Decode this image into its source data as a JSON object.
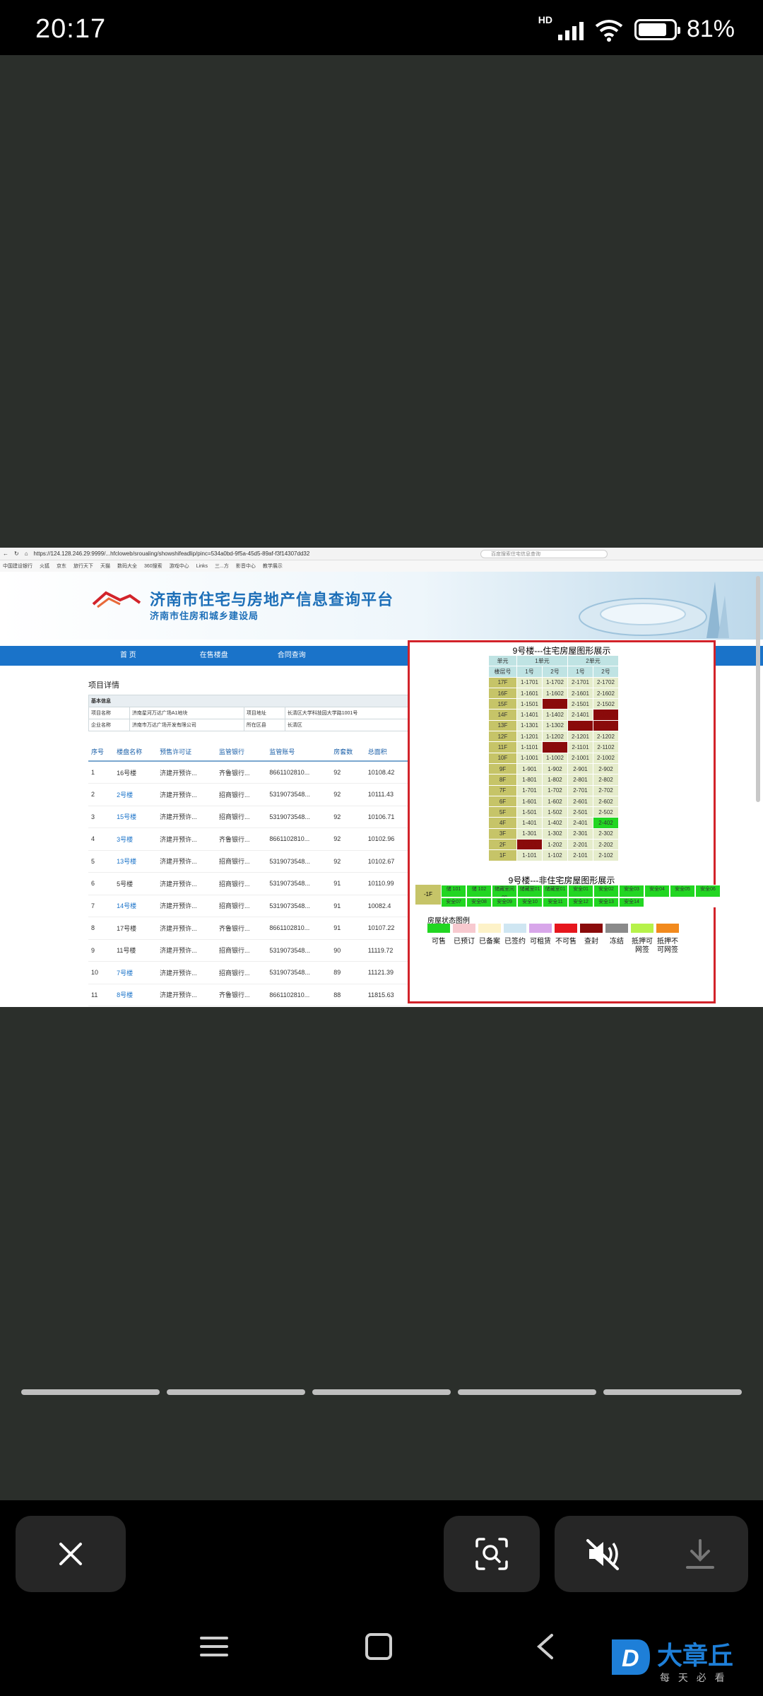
{
  "status_bar": {
    "time": "20:17",
    "network": "HD",
    "battery": "81%",
    "battery_level": 0.81
  },
  "browser": {
    "url": "https://124.128.246.29:9999/...hfcloweb/sroualing/showshifeadlip/pinc=534a0bd-9f5a-45d5-89af-f3f14307dd32",
    "search_placeholder": "百度搜索住宅信息查询",
    "bookmarks": [
      "中国建设银行",
      "火狐",
      "京东",
      "旅行天下",
      "天猫",
      "数码大全",
      "360搜索",
      "游戏中心",
      "Links",
      "三...方",
      "影音中心",
      "教学展示"
    ]
  },
  "site": {
    "title": "济南市住宅与房地产信息查询平台",
    "subtitle": "济南市住房和城乡建设局",
    "nav": [
      "首  页",
      "在售楼盘",
      "合同查询"
    ]
  },
  "project": {
    "section_title": "项目详情",
    "info_header": "基本信息",
    "info_rows": [
      [
        "项目名称",
        "济南星河万达广场A1地块",
        "项目地址",
        "长清区大学科技园大学路1001号"
      ],
      [
        "企业名称",
        "济南市万达广场开发有限公司",
        "所在区县",
        "长清区"
      ]
    ],
    "columns": [
      "序号",
      "楼盘名称",
      "预售许可证",
      "监管银行",
      "监管账号",
      "房套数",
      "总面积"
    ],
    "rows": [
      [
        "1",
        "16号楼",
        "济建开预许...",
        "齐鲁银行...",
        "8661102810...",
        "92",
        "10108.42"
      ],
      [
        "2",
        "2号楼",
        "济建开预许...",
        "招商银行...",
        "5319073548...",
        "92",
        "10111.43"
      ],
      [
        "3",
        "15号楼",
        "济建开预许...",
        "招商银行...",
        "5319073548...",
        "92",
        "10106.71"
      ],
      [
        "4",
        "3号楼",
        "济建开预许...",
        "齐鲁银行...",
        "8661102810...",
        "92",
        "10102.96"
      ],
      [
        "5",
        "13号楼",
        "济建开预许...",
        "招商银行...",
        "5319073548...",
        "92",
        "10102.67"
      ],
      [
        "6",
        "5号楼",
        "济建开预许...",
        "招商银行...",
        "5319073548...",
        "91",
        "10110.99"
      ],
      [
        "7",
        "14号楼",
        "济建开预许...",
        "招商银行...",
        "5319073548...",
        "91",
        "10082.4"
      ],
      [
        "8",
        "17号楼",
        "济建开预许...",
        "齐鲁银行...",
        "8661102810...",
        "91",
        "10107.22"
      ],
      [
        "9",
        "11号楼",
        "济建开预许...",
        "招商银行...",
        "5319073548...",
        "90",
        "11119.72"
      ],
      [
        "10",
        "7号楼",
        "济建开预许...",
        "招商银行...",
        "5319073548...",
        "89",
        "11121.39"
      ],
      [
        "11",
        "8号楼",
        "济建开预许...",
        "齐鲁银行...",
        "8661102810...",
        "88",
        "11815.63"
      ]
    ]
  },
  "building": {
    "title": "9号楼---住宅房屋图形展示",
    "unit_label": "单元",
    "units": [
      "1单元",
      "2单元"
    ],
    "floor_col": "楼层号",
    "room_cols": [
      "1号",
      "2号",
      "1号",
      "2号"
    ],
    "floors": [
      {
        "floor": "17F",
        "rooms": [
          "1-1701",
          "1-1702",
          "2-1701",
          "2-1702"
        ],
        "status": [
          "n",
          "n",
          "n",
          "n"
        ]
      },
      {
        "floor": "16F",
        "rooms": [
          "1-1601",
          "1-1602",
          "2-1601",
          "2-1602"
        ],
        "status": [
          "n",
          "n",
          "n",
          "n"
        ]
      },
      {
        "floor": "15F",
        "rooms": [
          "1-1501",
          "1-1502",
          "2-1501",
          "2-1502"
        ],
        "status": [
          "n",
          "d",
          "n",
          "n"
        ]
      },
      {
        "floor": "14F",
        "rooms": [
          "1-1401",
          "1-1402",
          "2-1401",
          "2-1402"
        ],
        "status": [
          "n",
          "n",
          "n",
          "d"
        ]
      },
      {
        "floor": "13F",
        "rooms": [
          "1-1301",
          "1-1302",
          "2-1301",
          "2-1302"
        ],
        "status": [
          "n",
          "n",
          "d",
          "d"
        ]
      },
      {
        "floor": "12F",
        "rooms": [
          "1-1201",
          "1-1202",
          "2-1201",
          "2-1202"
        ],
        "status": [
          "n",
          "n",
          "n",
          "n"
        ]
      },
      {
        "floor": "11F",
        "rooms": [
          "1-1101",
          "1-1102",
          "2-1101",
          "2-1102"
        ],
        "status": [
          "n",
          "d",
          "n",
          "n"
        ]
      },
      {
        "floor": "10F",
        "rooms": [
          "1-1001",
          "1-1002",
          "2-1001",
          "2-1002"
        ],
        "status": [
          "n",
          "n",
          "n",
          "n"
        ]
      },
      {
        "floor": "9F",
        "rooms": [
          "1-901",
          "1-902",
          "2-901",
          "2-902"
        ],
        "status": [
          "n",
          "n",
          "n",
          "n"
        ]
      },
      {
        "floor": "8F",
        "rooms": [
          "1-801",
          "1-802",
          "2-801",
          "2-802"
        ],
        "status": [
          "n",
          "n",
          "n",
          "n"
        ]
      },
      {
        "floor": "7F",
        "rooms": [
          "1-701",
          "1-702",
          "2-701",
          "2-702"
        ],
        "status": [
          "n",
          "n",
          "n",
          "n"
        ]
      },
      {
        "floor": "6F",
        "rooms": [
          "1-601",
          "1-602",
          "2-601",
          "2-602"
        ],
        "status": [
          "n",
          "n",
          "n",
          "n"
        ]
      },
      {
        "floor": "5F",
        "rooms": [
          "1-501",
          "1-502",
          "2-501",
          "2-502"
        ],
        "status": [
          "n",
          "n",
          "n",
          "n"
        ]
      },
      {
        "floor": "4F",
        "rooms": [
          "1-401",
          "1-402",
          "2-401",
          "2-402"
        ],
        "status": [
          "n",
          "n",
          "n",
          "g"
        ]
      },
      {
        "floor": "3F",
        "rooms": [
          "1-301",
          "1-302",
          "2-301",
          "2-302"
        ],
        "status": [
          "n",
          "n",
          "n",
          "n"
        ]
      },
      {
        "floor": "2F",
        "rooms": [
          "1-201",
          "1-202",
          "2-201",
          "2-202"
        ],
        "status": [
          "d",
          "n",
          "n",
          "n"
        ]
      },
      {
        "floor": "1F",
        "rooms": [
          "1-101",
          "1-102",
          "2-101",
          "2-102"
        ],
        "status": [
          "n",
          "n",
          "n",
          "n"
        ]
      }
    ],
    "nonres_title": "9号楼---非住宅房屋图形展示",
    "nonres_floor": "-1F",
    "nonres_cells": [
      "储 101",
      "储 102",
      "储藏室间08",
      "储藏室01",
      "储藏室01",
      "安全01",
      "安全02",
      "安全03",
      "安全04",
      "安全05",
      "安全06",
      "安全07",
      "安全08",
      "安全09",
      "安全10",
      "安全11",
      "安全12",
      "安全13",
      "安全14",
      "",
      "",
      ""
    ],
    "legend_title": "房屋状态图例",
    "legend": [
      {
        "label": "可售",
        "color": "#22d622"
      },
      {
        "label": "已预订",
        "color": "#f7c9cf"
      },
      {
        "label": "已备案",
        "color": "#fdf2c8"
      },
      {
        "label": "已签约",
        "color": "#cfe6f2"
      },
      {
        "label": "可租赁",
        "color": "#d8a6ea"
      },
      {
        "label": "不可售",
        "color": "#e6161d"
      },
      {
        "label": "查封",
        "color": "#8a0b0b"
      },
      {
        "label": "冻结",
        "color": "#8a8a8a"
      },
      {
        "label": "抵押可网签",
        "color": "#b6f24a"
      },
      {
        "label": "抵押不可网签",
        "color": "#f28a1d"
      }
    ]
  },
  "viewer": {
    "close_icon": "close-icon",
    "lens_icon": "lens-scan-icon",
    "mute_icon": "mute-icon",
    "download_icon": "download-icon"
  },
  "watermark": {
    "logo_letter": "D",
    "brand": "大章丘",
    "slogan": "每 天 必 看"
  }
}
